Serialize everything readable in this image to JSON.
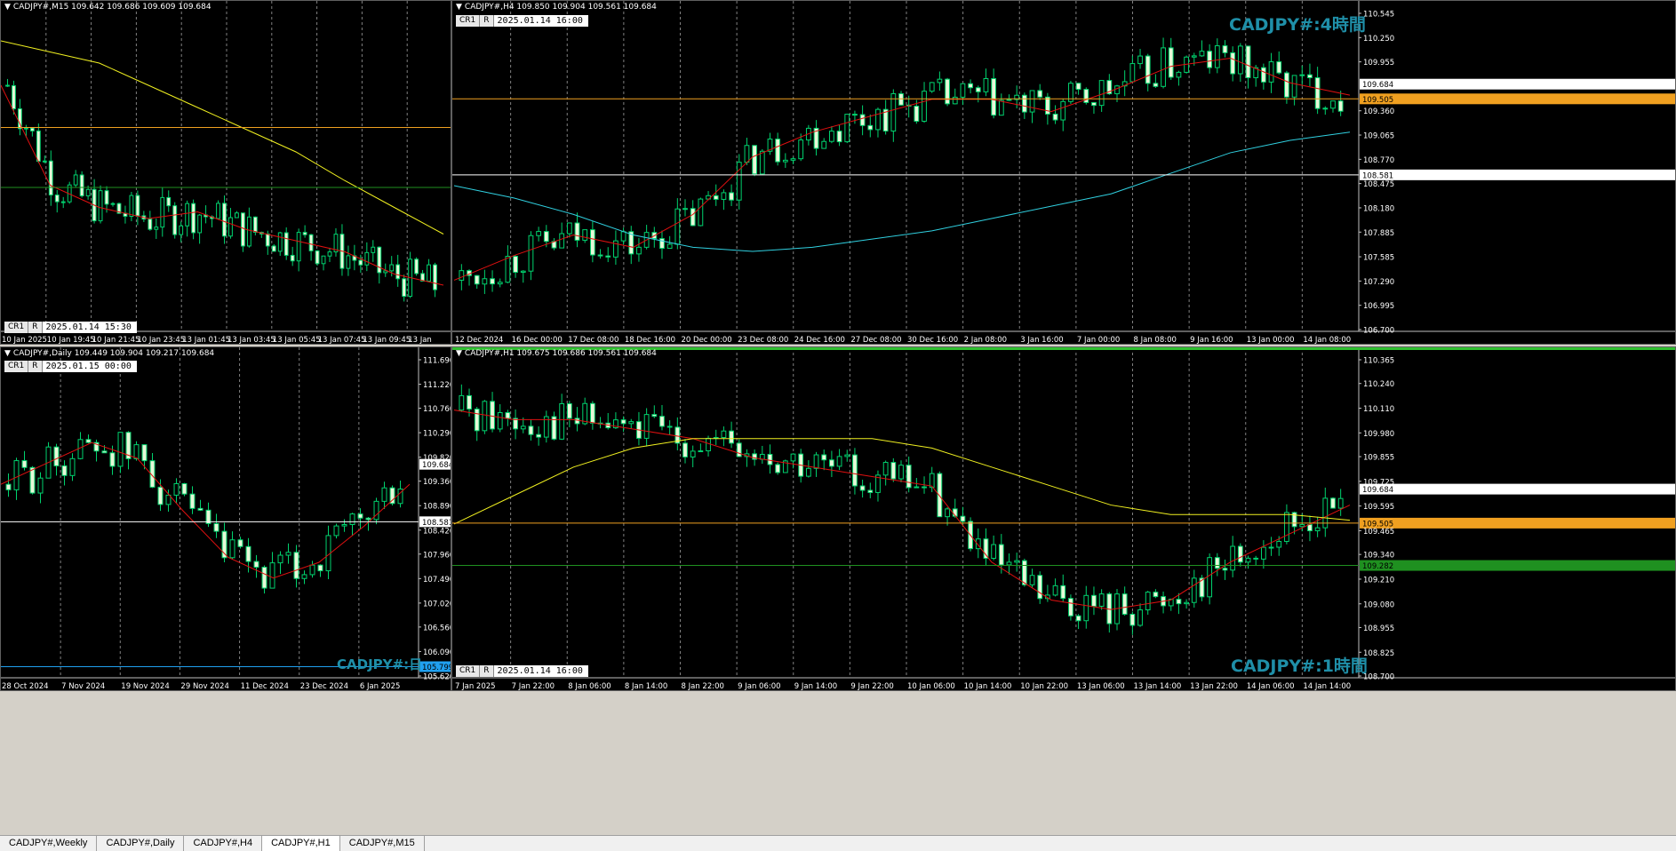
{
  "tabs": [
    "CADJPY#,Weekly",
    "CADJPY#,Daily",
    "CADJPY#,H4",
    "CADJPY#,H1",
    "CADJPY#,M15"
  ],
  "active_tab": 3,
  "ctrl_labels": {
    "cr": "CR1",
    "r": "R"
  },
  "colors": {
    "bull": "#000000",
    "bull_border": "#00d26e",
    "bear": "#e8f8d8",
    "bear_border": "#00d26e",
    "ma_red": "#e01010",
    "ma_yellow": "#f0f020",
    "ma_cyan": "#30d0e0",
    "hline_orange": "#f0a020",
    "hline_white": "#ffffff",
    "hline_green": "#1f9020",
    "hline_blue": "#20a0f0",
    "price_tag": "#ffffff",
    "grid": "#808080",
    "axis_text": "#ffffff"
  },
  "panels": {
    "m15": {
      "header": "CADJPY#,M15  109.642 109.686 109.609 109.684",
      "time": "2025.01.14 15:30",
      "watermark": "",
      "price_labels": [],
      "time_labels": [
        "10 Jan 2025",
        "10 Jan 19:45",
        "10 Jan 21:45",
        "10 Jan 23:45",
        "13 Jan 01:45",
        "13 Jan 03:45",
        "13 Jan 05:45",
        "13 Jan 07:45",
        "13 Jan 09:45",
        "13 Jan"
      ]
    },
    "h4": {
      "header": "CADJPY#,H4  109.850 109.904 109.561 109.684",
      "time": "2025.01.14 16:00",
      "watermark": "CADJPY#:4時間",
      "price_labels": [
        "110.545",
        "110.250",
        "109.955",
        "109.684",
        "109.505",
        "109.360",
        "109.065",
        "108.770",
        "108.581",
        "108.475",
        "108.180",
        "107.885",
        "107.585",
        "107.290",
        "106.995",
        "106.700"
      ],
      "time_labels": [
        "12 Dec 2024",
        "16 Dec 00:00",
        "17 Dec 08:00",
        "18 Dec 16:00",
        "20 Dec 00:00",
        "23 Dec 08:00",
        "24 Dec 16:00",
        "27 Dec 08:00",
        "30 Dec 16:00",
        "2 Jan 08:00",
        "3 Jan 16:00",
        "7 Jan 00:00",
        "8 Jan 08:00",
        "9 Jan 16:00",
        "13 Jan 00:00",
        "14 Jan 08:00"
      ]
    },
    "daily": {
      "header": "CADJPY#,Daily  109.449 109.904 109.217 109.684",
      "time": "2025.01.15 00:00",
      "watermark": "CADJPY#:日",
      "price_labels": [
        "111.690",
        "111.220",
        "110.760",
        "110.290",
        "109.820",
        "109.684",
        "109.360",
        "108.890",
        "108.581",
        "108.420",
        "107.960",
        "107.490",
        "107.020",
        "106.560",
        "106.090",
        "105.799",
        "105.620"
      ],
      "time_labels": [
        "28 Oct 2024",
        "7 Nov 2024",
        "19 Nov 2024",
        "29 Nov 2024",
        "11 Dec 2024",
        "23 Dec 2024",
        "6 Jan 2025"
      ]
    },
    "h1": {
      "header": "CADJPY#,H1  109.675 109.686 109.561 109.684",
      "time": "2025.01.14 16:00",
      "watermark": "CADJPY#:1時間",
      "price_labels": [
        "110.365",
        "110.240",
        "110.110",
        "109.980",
        "109.855",
        "109.725",
        "109.684",
        "109.595",
        "109.505",
        "109.465",
        "109.340",
        "109.282",
        "109.210",
        "109.080",
        "108.955",
        "108.825",
        "108.700"
      ],
      "time_labels": [
        "7 Jan 2025",
        "7 Jan 22:00",
        "8 Jan 06:00",
        "8 Jan 14:00",
        "8 Jan 22:00",
        "9 Jan 06:00",
        "9 Jan 14:00",
        "9 Jan 22:00",
        "10 Jan 06:00",
        "10 Jan 14:00",
        "10 Jan 22:00",
        "13 Jan 06:00",
        "13 Jan 14:00",
        "13 Jan 22:00",
        "14 Jan 06:00",
        "14 Jan 14:00"
      ]
    }
  },
  "chart_data": [
    {
      "type": "candlestick",
      "title": "CADJPY#,M15",
      "ylim": [
        108.95,
        110.35
      ],
      "series": [
        {
          "name": "MA",
          "values": [
            110.05,
            109.6,
            109.5,
            109.45,
            109.48,
            109.4,
            109.35,
            109.3,
            109.2,
            109.15
          ]
        },
        {
          "name": "MA",
          "values": [
            110.25,
            110.2,
            110.15,
            110.05,
            109.95,
            109.85,
            109.75,
            109.62,
            109.5,
            109.38
          ]
        }
      ],
      "hlines": [
        109.86,
        109.59
      ],
      "close": 109.684
    },
    {
      "type": "candlestick",
      "title": "CADJPY#,H4",
      "ylim": [
        106.7,
        110.545
      ],
      "series": [
        {
          "name": "MA",
          "values": [
            107.3,
            107.6,
            107.85,
            107.7,
            108.1,
            108.8,
            109.1,
            109.3,
            109.5,
            109.5,
            109.35,
            109.6,
            109.9,
            110.0,
            109.7,
            109.55
          ]
        },
        {
          "name": "MA",
          "values": [
            108.45,
            108.3,
            108.1,
            107.85,
            107.7,
            107.65,
            107.7,
            107.8,
            107.9,
            108.05,
            108.2,
            108.35,
            108.6,
            108.85,
            109.0,
            109.1
          ]
        }
      ],
      "hlines": [
        109.505,
        108.581
      ],
      "close": 109.684
    },
    {
      "type": "candlestick",
      "title": "CADJPY#,Daily",
      "ylim": [
        105.62,
        111.69
      ],
      "series": [
        {
          "name": "MA",
          "values": [
            109.3,
            109.7,
            110.1,
            109.8,
            108.8,
            107.9,
            107.5,
            107.8,
            108.5,
            109.3
          ]
        }
      ],
      "hlines": [
        108.581,
        105.799
      ],
      "close": 109.684
    },
    {
      "type": "candlestick",
      "title": "CADJPY#,H1",
      "ylim": [
        108.7,
        110.365
      ],
      "series": [
        {
          "name": "MA",
          "values": [
            110.1,
            110.05,
            110.05,
            110.0,
            109.95,
            109.85,
            109.8,
            109.75,
            109.7,
            109.3,
            109.1,
            109.05,
            109.1,
            109.3,
            109.45,
            109.6
          ]
        },
        {
          "name": "MA",
          "values": [
            109.5,
            109.65,
            109.8,
            109.9,
            109.95,
            109.95,
            109.95,
            109.95,
            109.9,
            109.8,
            109.7,
            109.6,
            109.55,
            109.55,
            109.55,
            109.52
          ]
        }
      ],
      "hlines": [
        109.505,
        109.282
      ],
      "close": 109.684
    }
  ]
}
